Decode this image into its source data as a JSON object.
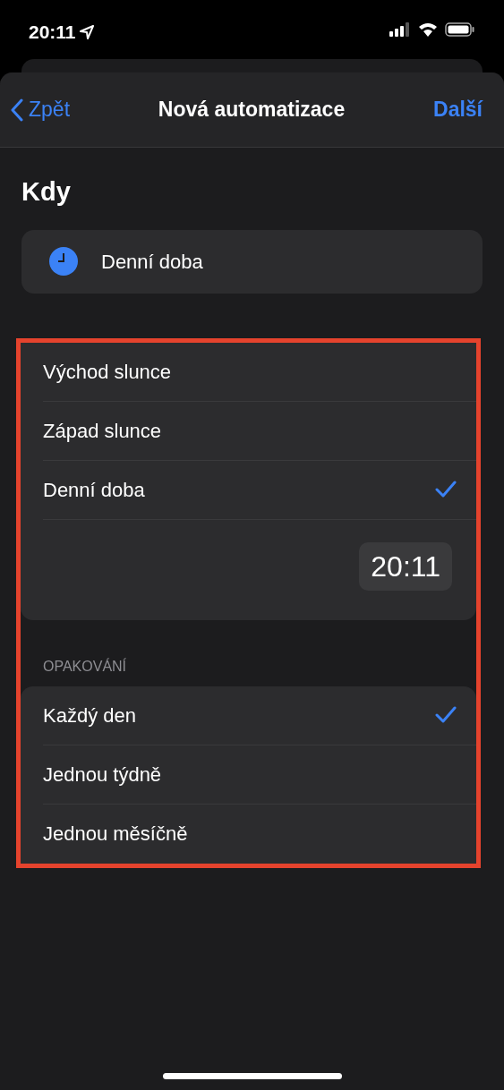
{
  "status_bar": {
    "time": "20:11"
  },
  "nav": {
    "back": "Zpět",
    "title": "Nová automatizace",
    "next": "Další"
  },
  "heading": "Kdy",
  "trigger": {
    "label": "Denní doba"
  },
  "options": [
    {
      "label": "Východ slunce",
      "selected": false
    },
    {
      "label": "Západ slunce",
      "selected": false
    },
    {
      "label": "Denní doba",
      "selected": true
    }
  ],
  "time_value": "20:11",
  "repeat_header": "OPAKOVÁNÍ",
  "repeat": [
    {
      "label": "Každý den",
      "selected": true
    },
    {
      "label": "Jednou týdně",
      "selected": false
    },
    {
      "label": "Jednou měsíčně",
      "selected": false
    }
  ]
}
